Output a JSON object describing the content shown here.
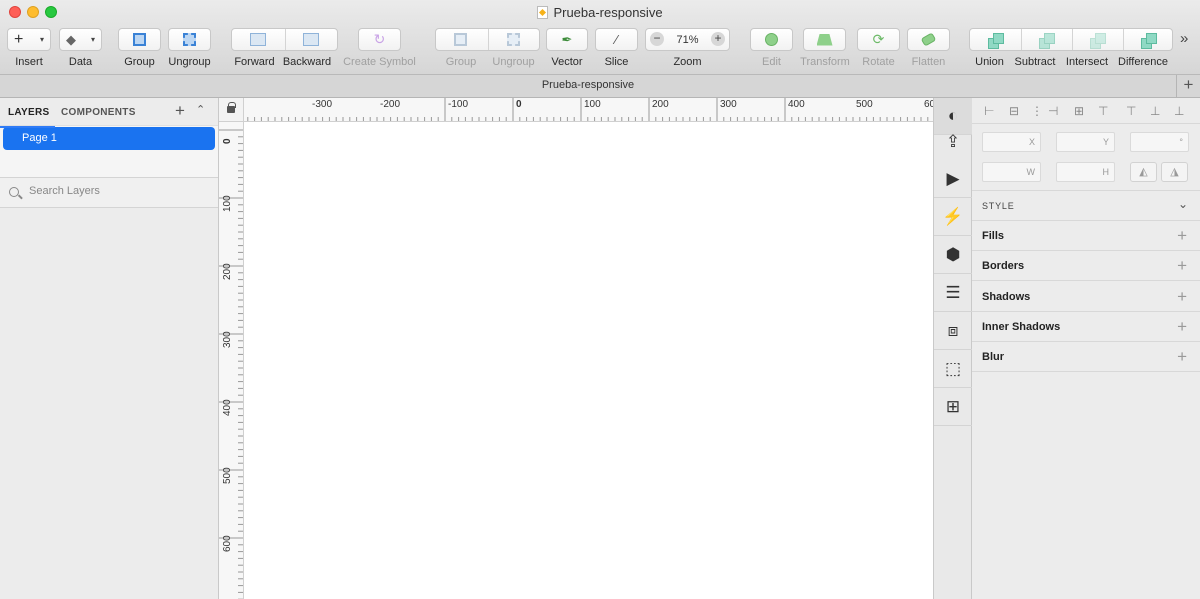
{
  "window": {
    "title": "Prueba-responsive"
  },
  "toolbar": {
    "insert": "Insert",
    "data": "Data",
    "group": "Group",
    "ungroup": "Ungroup",
    "forward": "Forward",
    "backward": "Backward",
    "create_symbol": "Create Symbol",
    "group2": "Group",
    "ungroup2": "Ungroup",
    "vector": "Vector",
    "slice": "Slice",
    "zoom": "Zoom",
    "zoom_value": "71%",
    "edit": "Edit",
    "transform": "Transform",
    "rotate": "Rotate",
    "flatten": "Flatten",
    "union": "Union",
    "subtract": "Subtract",
    "intersect": "Intersect",
    "difference": "Difference",
    "overflow": "»"
  },
  "tabbar": {
    "title": "Prueba-responsive",
    "add": "+"
  },
  "left_panel": {
    "tab_layers": "LAYERS",
    "tab_components": "COMPONENTS",
    "add": "+",
    "collapse": "⌃",
    "page_selected": "Page 1",
    "search_placeholder": "Search Layers"
  },
  "ruler": {
    "horizontal_labels": [
      "-300",
      "-200",
      "-100",
      "0",
      "100",
      "200",
      "300",
      "400",
      "500",
      "60"
    ],
    "vertical_labels": [
      "0",
      "100",
      "200",
      "300",
      "400",
      "500",
      "600"
    ]
  },
  "inspector": {
    "x_label": "X",
    "y_label": "Y",
    "rotation_label": "°",
    "w_label": "W",
    "h_label": "H",
    "style": "STYLE",
    "fills": "Fills",
    "borders": "Borders",
    "shadows": "Shadows",
    "inner_shadows": "Inner Shadows",
    "blur": "Blur",
    "plus": "+"
  },
  "colors": {
    "accent": "#1a73f0",
    "close": "#fe5f57",
    "minimize": "#febc2e",
    "maximize": "#28c840"
  }
}
